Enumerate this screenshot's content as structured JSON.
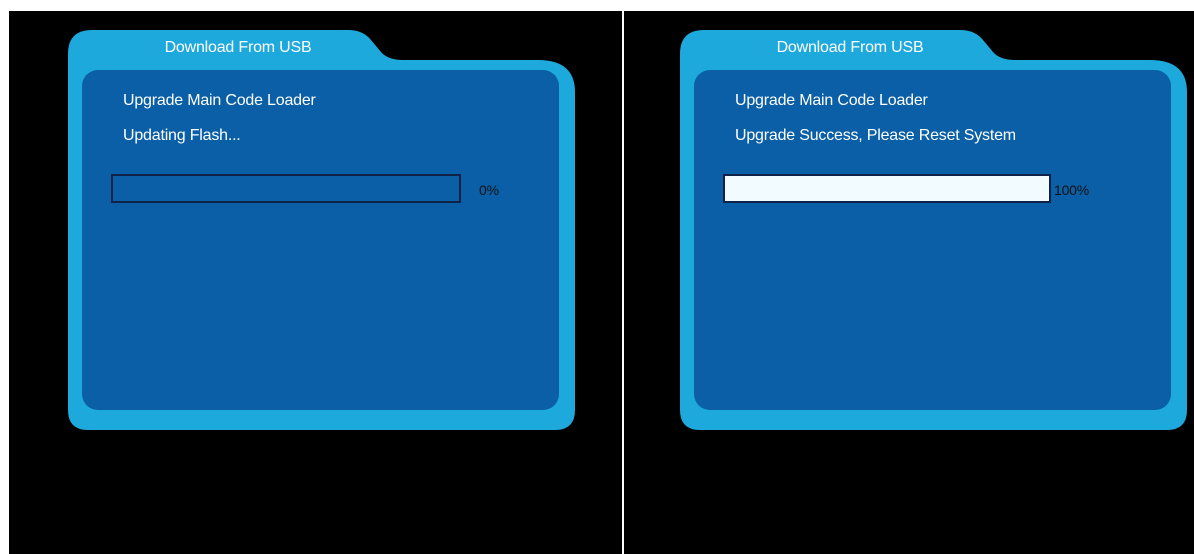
{
  "colors": {
    "frame_outer": "#1ea9dc",
    "panel_inner": "#0a5fa6",
    "progress_fill": "#f2fbff",
    "background": "#000000"
  },
  "screens": [
    {
      "title": "Download From USB",
      "line1": "Upgrade Main Code Loader",
      "line2": "Updating Flash...",
      "progress": 0,
      "percent_label": "0%"
    },
    {
      "title": "Download From USB",
      "line1": "Upgrade Main Code Loader",
      "line2": "Upgrade Success, Please Reset System",
      "progress": 1,
      "percent_label": "100%"
    }
  ]
}
